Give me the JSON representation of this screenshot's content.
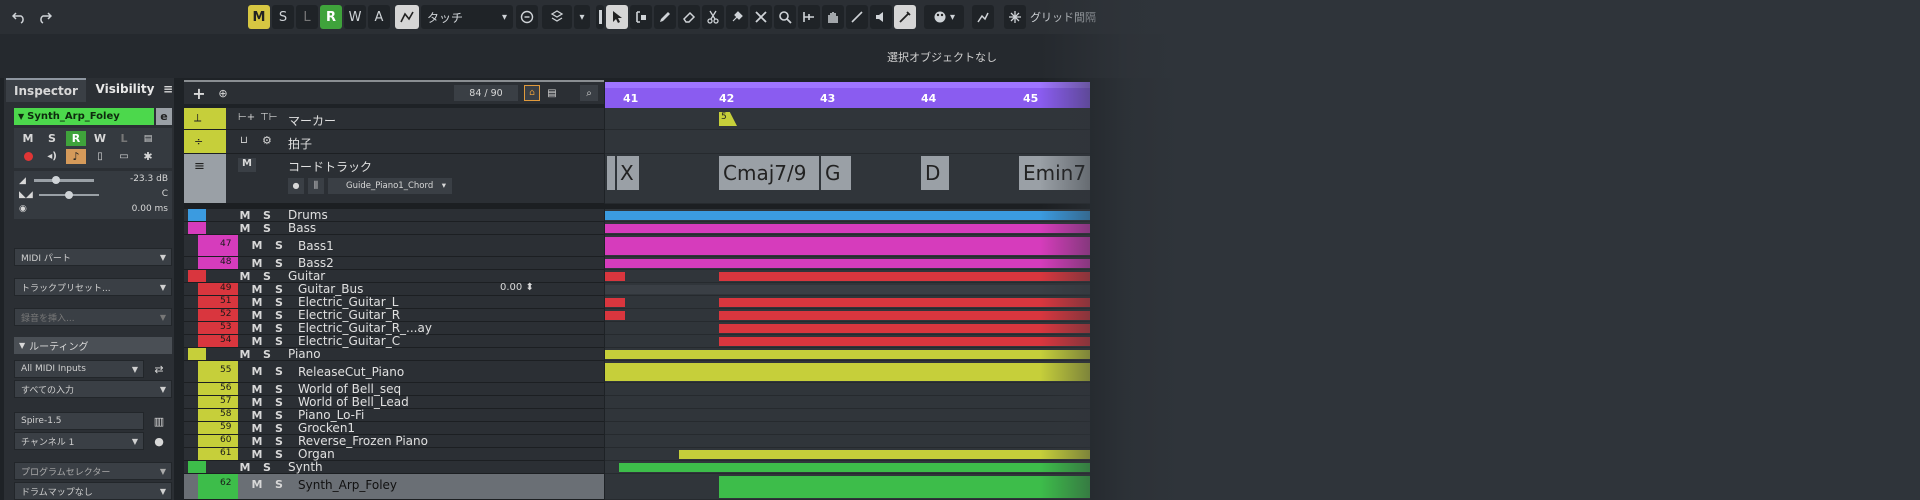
{
  "toolbar": {
    "buttons": [
      "M",
      "S",
      "L",
      "R",
      "W",
      "A"
    ],
    "automation_mode": "タッチ",
    "automation_arrow": "▾",
    "snap_label": "グリッド間隔"
  },
  "status": {
    "selection": "選択オブジェクトなし"
  },
  "inspector": {
    "tabs": [
      "Inspector",
      "Visibility"
    ],
    "menu_icon": "≡",
    "track_name": "Synth_Arp_Foley",
    "edit_icon": "e",
    "buttons_row1": [
      "M",
      "S",
      "R",
      "W",
      "L",
      "▤"
    ],
    "volume": "-23.3 dB",
    "pan": "C",
    "delay": "0.00 ms",
    "midi_part": "MIDI パート",
    "track_preset": "トラックプリセット...",
    "insert": "録音を挿入...",
    "routing": "ルーティング",
    "input": "All MIDI Inputs",
    "all_inputs": "すべての入力",
    "instrument": "Spire-1.5",
    "channel": "チャンネル 1",
    "program_selector": "プログラムセレクター",
    "drum_map": "ドラムマップなし"
  },
  "tracklist": {
    "header_count": "84 / 90",
    "marker_track": "マーカー",
    "signature_track": "拍子",
    "chord_track": "コードトラック",
    "chord_voicing": "Guide_Piano1_Chord",
    "bus_value": "0.00",
    "rows": [
      {
        "num": "",
        "name": "Drums",
        "color": "#3b9be0"
      },
      {
        "num": "",
        "name": "Bass",
        "color": "#d63cbc"
      },
      {
        "num": "47",
        "name": "Bass1",
        "color": "#d63cbc"
      },
      {
        "num": "48",
        "name": "Bass2",
        "color": "#d63cbc"
      },
      {
        "num": "",
        "name": "Guitar",
        "color": "#d9363e"
      },
      {
        "num": "49",
        "name": "Guitar_Bus",
        "color": "#d9363e"
      },
      {
        "num": "51",
        "name": "Electric_Guitar_L",
        "color": "#d9363e"
      },
      {
        "num": "52",
        "name": "Electric_Guitar_R",
        "color": "#d9363e"
      },
      {
        "num": "53",
        "name": "Electric_Guitar_R_...ay",
        "color": "#d9363e"
      },
      {
        "num": "54",
        "name": "Electric_Guitar_C",
        "color": "#d9363e"
      },
      {
        "num": "",
        "name": "Piano",
        "color": "#c6cf3a"
      },
      {
        "num": "55",
        "name": "ReleaseCut_Piano",
        "color": "#c6cf3a"
      },
      {
        "num": "56",
        "name": "World of Bell_seq",
        "color": "#c6cf3a"
      },
      {
        "num": "57",
        "name": "World of Bell_Lead",
        "color": "#c6cf3a"
      },
      {
        "num": "58",
        "name": "Piano_Lo-Fi",
        "color": "#c6cf3a"
      },
      {
        "num": "59",
        "name": "Grocken1",
        "color": "#c6cf3a"
      },
      {
        "num": "60",
        "name": "Reverse_Frozen Piano",
        "color": "#c6cf3a"
      },
      {
        "num": "61",
        "name": "Organ",
        "color": "#c6cf3a"
      },
      {
        "num": "",
        "name": "Synth",
        "color": "#3dbd4a"
      },
      {
        "num": "62",
        "name": "Synth_Arp_Foley",
        "color": "#3dbd4a"
      }
    ]
  },
  "ruler": {
    "bars": [
      "41",
      "42",
      "43",
      "44",
      "45"
    ]
  },
  "marker": {
    "label": "5"
  },
  "chords": [
    "X",
    "X",
    "Cmaj7/9",
    "G",
    "D",
    "Emin7"
  ],
  "colors": {
    "accent_ruler": "#8a5cf0",
    "selected_track": "#4cd84c"
  }
}
